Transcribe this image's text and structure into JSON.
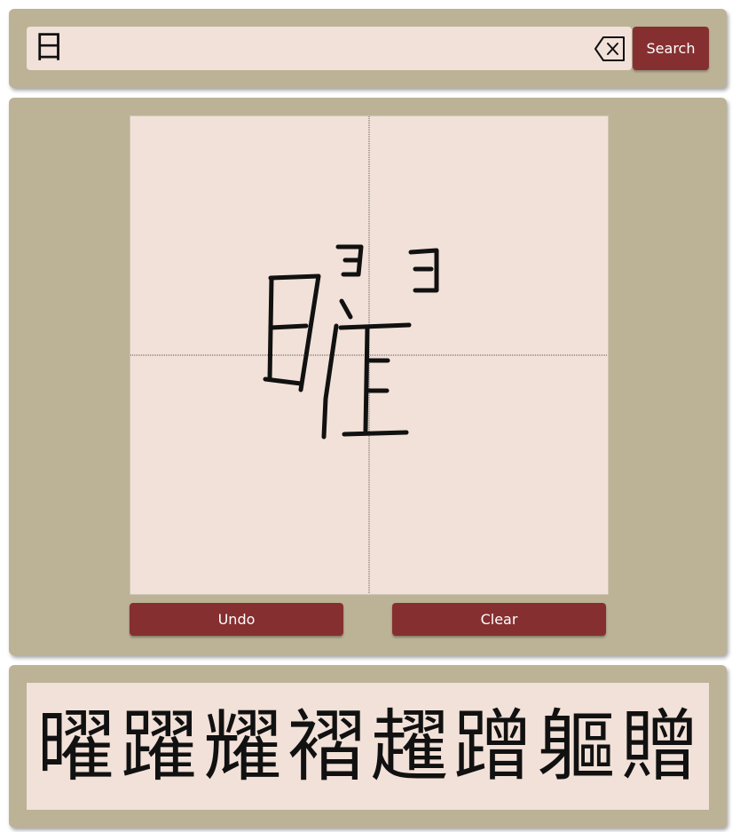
{
  "search": {
    "value": "日",
    "button_label": "Search",
    "clear_icon": "backspace-x-icon"
  },
  "drawing": {
    "guide_lines": "center-cross-dotted",
    "stroke_color": "#111111",
    "background_color": "#f2e1d8"
  },
  "actions": {
    "undo_label": "Undo",
    "clear_label": "Clear"
  },
  "results": {
    "candidates": [
      "曜",
      "躍",
      "耀",
      "褶",
      "趯",
      "蹭",
      "軀",
      "贈"
    ]
  },
  "colors": {
    "panel": "#bcb296",
    "input_bg": "#f2e1d8",
    "button": "#862f31",
    "button_text": "#ffffff"
  }
}
